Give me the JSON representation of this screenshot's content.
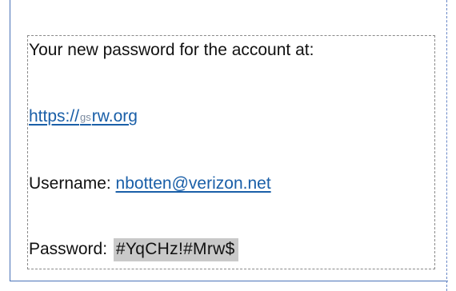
{
  "message": {
    "heading": "Your new password for the account at:",
    "url": {
      "prefix": "https://",
      "small": "gs",
      "suffix": "rw.org"
    },
    "username": {
      "label": "Username: ",
      "value": "nbotten@verizon.net"
    },
    "password": {
      "label": "Password: ",
      "value": "#YqCHz!#Mrw$"
    }
  },
  "colors": {
    "link": "#1a5fa8",
    "password_highlight": "#c9c9c9",
    "page_edge": "#4a73b8",
    "dashed_border": "#8a8a8a"
  }
}
